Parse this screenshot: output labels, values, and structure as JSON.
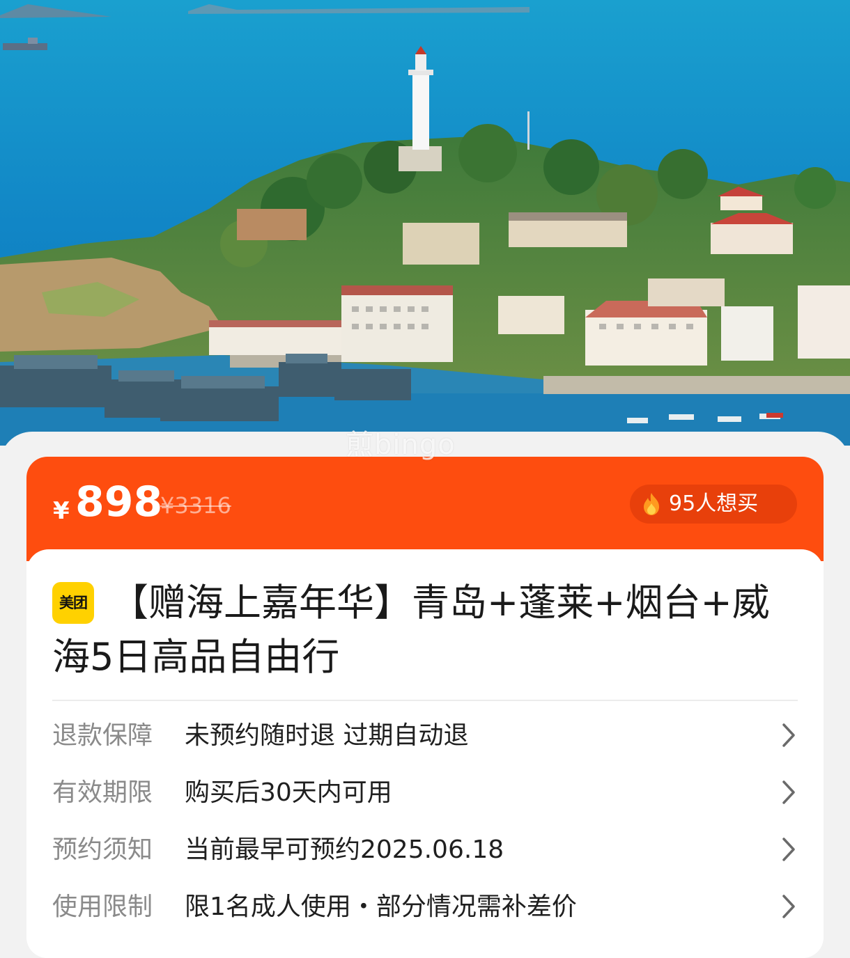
{
  "hero": {
    "watermark": "煎bingo"
  },
  "price_bar": {
    "currency": "¥",
    "price": "898",
    "original_price": "¥3316",
    "want_count": "95人想买",
    "want_icon": "flame-icon"
  },
  "product": {
    "brand_badge": "美团",
    "title": "【赠海上嘉年华】青岛+蓬莱+烟台+威海5日高品自由行"
  },
  "info_rows": [
    {
      "label": "退款保障",
      "value": "未预约随时退 过期自动退"
    },
    {
      "label": "有效期限",
      "value": "购买后30天内可用"
    },
    {
      "label": "预约须知",
      "value": "当前最早可预约2025.06.18"
    },
    {
      "label": "使用限制",
      "value": "限1名成人使用・部分情况需补差价"
    }
  ],
  "colors": {
    "accent_orange": "#fe4d0f",
    "brand_yellow": "#ffd100"
  }
}
